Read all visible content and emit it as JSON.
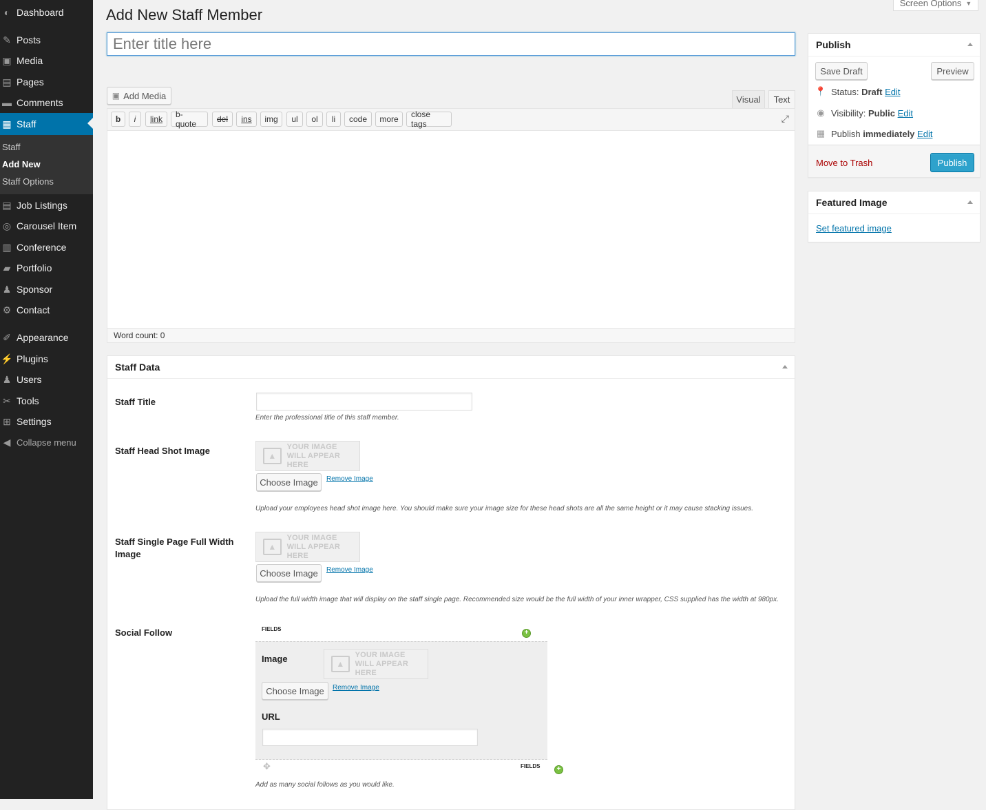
{
  "sidebar": {
    "items": [
      {
        "label": "Dashboard",
        "icon": "dashboard-icon",
        "glyph": "◐"
      },
      {
        "label": "Posts",
        "icon": "pin-icon",
        "glyph": "✎"
      },
      {
        "label": "Media",
        "icon": "media-icon",
        "glyph": "▣"
      },
      {
        "label": "Pages",
        "icon": "pages-icon",
        "glyph": "▤"
      },
      {
        "label": "Comments",
        "icon": "comments-icon",
        "glyph": "▬"
      },
      {
        "label": "Staff",
        "icon": "staff-icon",
        "glyph": "▦"
      },
      {
        "label": "Job Listings",
        "icon": "listings-icon",
        "glyph": "▤"
      },
      {
        "label": "Carousel Item",
        "icon": "carousel-icon",
        "glyph": "◎"
      },
      {
        "label": "Conference",
        "icon": "calendar-icon",
        "glyph": "▥"
      },
      {
        "label": "Portfolio",
        "icon": "folder-icon",
        "glyph": "▰"
      },
      {
        "label": "Sponsor",
        "icon": "people-icon",
        "glyph": "♟"
      },
      {
        "label": "Contact",
        "icon": "gear-icon",
        "glyph": "⚙"
      },
      {
        "label": "Appearance",
        "icon": "brush-icon",
        "glyph": "✐"
      },
      {
        "label": "Plugins",
        "icon": "plug-icon",
        "glyph": "⚡"
      },
      {
        "label": "Users",
        "icon": "user-icon",
        "glyph": "♟"
      },
      {
        "label": "Tools",
        "icon": "wrench-icon",
        "glyph": "✂"
      },
      {
        "label": "Settings",
        "icon": "settings-icon",
        "glyph": "⊞"
      }
    ],
    "submenu": [
      "Staff",
      "Add New",
      "Staff Options"
    ],
    "collapse_label": "Collapse menu"
  },
  "header": {
    "title": "Add New Staff Member",
    "screen_options": "Screen Options",
    "title_placeholder": "Enter title here"
  },
  "editor": {
    "add_media": "Add Media",
    "tabs": [
      "Visual",
      "Text"
    ],
    "quicktags": [
      "b",
      "i",
      "link",
      "b-quote",
      "del",
      "ins",
      "img",
      "ul",
      "ol",
      "li",
      "code",
      "more",
      "close tags"
    ],
    "word_count": "Word count: 0"
  },
  "publish": {
    "title": "Publish",
    "save_draft": "Save Draft",
    "preview": "Preview",
    "status_label": "Status:",
    "status_value": "Draft",
    "visibility_label": "Visibility:",
    "visibility_value": "Public",
    "schedule_label": "Publish",
    "schedule_value": "immediately",
    "edit": "Edit",
    "trash": "Move to Trash",
    "publish_button": "Publish"
  },
  "featured_image": {
    "title": "Featured Image",
    "link": "Set featured image"
  },
  "staff_data": {
    "title": "Staff Data",
    "staff_title_label": "Staff Title",
    "staff_title_desc": "Enter the professional title of this staff member.",
    "head_shot_label": "Staff Head Shot Image",
    "head_shot_desc": "Upload your employees head shot image here. You should make sure your image size for these head shots are all the same height or it may cause stacking issues.",
    "full_width_label": "Staff Single Page Full Width Image",
    "full_width_desc": "Upload the full width image that will display on the staff single page. Recommended size would be the full width of your inner wrapper, CSS supplied has the width at 980px.",
    "placeholder_line1": "YOUR IMAGE",
    "placeholder_line2": "WILL APPEAR HERE",
    "choose_image": "Choose Image",
    "remove_image": "Remove Image",
    "social_label": "Social Follow",
    "fields": "FIELDS",
    "image_label": "Image",
    "url_label": "URL",
    "social_desc": "Add as many social follows as you would like."
  },
  "colors": {
    "accent": "#0073aa",
    "publish": "#2ea2cc",
    "trash": "#a00",
    "sidebar": "#222"
  }
}
